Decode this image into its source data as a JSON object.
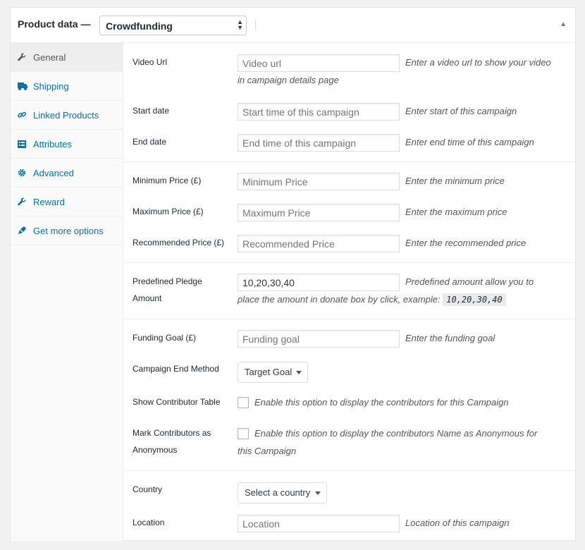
{
  "header": {
    "title": "Product data —",
    "product_type": "Crowdfunding"
  },
  "tabs": [
    {
      "label": "General",
      "icon": "wrench-icon"
    },
    {
      "label": "Shipping",
      "icon": "truck-icon"
    },
    {
      "label": "Linked Products",
      "icon": "link-icon"
    },
    {
      "label": "Attributes",
      "icon": "list-icon"
    },
    {
      "label": "Advanced",
      "icon": "gear-icon"
    },
    {
      "label": "Reward",
      "icon": "wrench-icon"
    },
    {
      "label": "Get more options",
      "icon": "extension-icon"
    }
  ],
  "fields": {
    "video_url": {
      "label": "Video Url",
      "placeholder": "Video url",
      "desc_1": "Enter a video url to show your video",
      "desc_2": "in campaign details page"
    },
    "start_date": {
      "label": "Start date",
      "placeholder": "Start time of this campaign",
      "desc": "Enter start of this campaign"
    },
    "end_date": {
      "label": "End date",
      "placeholder": "End time of this campaign",
      "desc": "Enter end time of this campaign"
    },
    "min_price": {
      "label": "Minimum Price (£)",
      "placeholder": "Minimum Price",
      "desc": "Enter the minimum price"
    },
    "max_price": {
      "label": "Maximum Price (£)",
      "placeholder": "Maximum Price",
      "desc": "Enter the maximum price"
    },
    "rec_price": {
      "label": "Recommended Price (£)",
      "placeholder": "Recommended Price",
      "desc": "Enter the recommended price"
    },
    "pledge": {
      "label_1": "Predefined Pledge",
      "label_2": "Amount",
      "value": "10,20,30,40",
      "desc_1": "Predefined amount allow you to",
      "desc_2": "place the amount in donate box by click, example:",
      "example": "10,20,30,40"
    },
    "goal": {
      "label": "Funding Goal (£)",
      "placeholder": "Funding goal",
      "desc": "Enter the funding goal"
    },
    "end_method": {
      "label": "Campaign End Method",
      "value": "Target Goal"
    },
    "contributor_table": {
      "label": "Show Contributor Table",
      "desc": "Enable this option to display the contributors for this Campaign"
    },
    "anonymous": {
      "label_1": "Mark Contributors as",
      "label_2": "Anonymous",
      "desc_1": "Enable this option to display the contributors Name as Anonymous for",
      "desc_2": "this Campaign"
    },
    "country": {
      "label": "Country",
      "value": "Select a country"
    },
    "location": {
      "label": "Location",
      "placeholder": "Location",
      "desc": "Location of this campaign"
    }
  },
  "colors": {
    "link": "#0073aa",
    "active_tab_bg": "#eeeeee"
  }
}
